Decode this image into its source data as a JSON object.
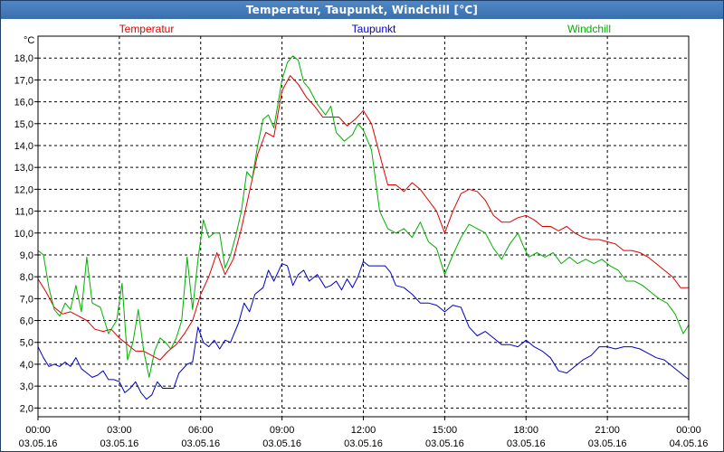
{
  "window": {
    "title": "Temperatur, Taupunkt, Windchill [°C]"
  },
  "chart_data": {
    "type": "line",
    "title": "Temperatur, Taupunkt, Windchill [°C]",
    "ylabel": "°C",
    "ylim": [
      1.6,
      19.0
    ],
    "y_ticks": [
      "2,0",
      "3,0",
      "4,0",
      "5,0",
      "6,0",
      "7,0",
      "8,0",
      "9,0",
      "10,0",
      "11,0",
      "12,0",
      "13,0",
      "14,0",
      "15,0",
      "16,0",
      "17,0",
      "18,0"
    ],
    "x_ticks": [
      {
        "time": "00:00",
        "date": "03.05.16"
      },
      {
        "time": "03:00",
        "date": "03.05.16"
      },
      {
        "time": "06:00",
        "date": "03.05.16"
      },
      {
        "time": "09:00",
        "date": "03.05.16"
      },
      {
        "time": "12:00",
        "date": "03.05.16"
      },
      {
        "time": "15:00",
        "date": "03.05.16"
      },
      {
        "time": "18:00",
        "date": "03.05.16"
      },
      {
        "time": "21:00",
        "date": "03.05.16"
      },
      {
        "time": "00:00",
        "date": "04.05.16"
      }
    ],
    "x_unit": "hours from 03.05.16 00:00",
    "xlim": [
      0,
      24
    ],
    "grid": true,
    "series": [
      {
        "name": "Temperatur",
        "color": "#e00000",
        "points": [
          [
            0,
            7.9
          ],
          [
            0.3,
            7.3
          ],
          [
            0.6,
            6.6
          ],
          [
            0.9,
            6.3
          ],
          [
            1.2,
            6.4
          ],
          [
            1.5,
            6.2
          ],
          [
            1.8,
            6.0
          ],
          [
            2.1,
            5.6
          ],
          [
            2.4,
            5.5
          ],
          [
            2.7,
            5.6
          ],
          [
            3.0,
            5.2
          ],
          [
            3.3,
            4.9
          ],
          [
            3.6,
            4.6
          ],
          [
            3.9,
            4.6
          ],
          [
            4.2,
            4.4
          ],
          [
            4.5,
            4.2
          ],
          [
            4.8,
            4.6
          ],
          [
            5.1,
            4.9
          ],
          [
            5.4,
            5.4
          ],
          [
            5.7,
            6.0
          ],
          [
            6.0,
            7.2
          ],
          [
            6.3,
            8.0
          ],
          [
            6.6,
            9.1
          ],
          [
            6.9,
            8.1
          ],
          [
            7.2,
            8.8
          ],
          [
            7.5,
            10.2
          ],
          [
            7.8,
            11.9
          ],
          [
            8.1,
            13.6
          ],
          [
            8.4,
            14.6
          ],
          [
            8.7,
            14.4
          ],
          [
            9.0,
            16.5
          ],
          [
            9.3,
            17.2
          ],
          [
            9.6,
            16.8
          ],
          [
            9.9,
            16.2
          ],
          [
            10.2,
            15.8
          ],
          [
            10.5,
            15.3
          ],
          [
            10.8,
            15.3
          ],
          [
            11.1,
            15.3
          ],
          [
            11.4,
            14.9
          ],
          [
            11.7,
            15.2
          ],
          [
            12.0,
            15.6
          ],
          [
            12.3,
            15.0
          ],
          [
            12.6,
            13.6
          ],
          [
            12.9,
            12.2
          ],
          [
            13.2,
            12.2
          ],
          [
            13.5,
            11.9
          ],
          [
            13.8,
            12.3
          ],
          [
            14.1,
            12.0
          ],
          [
            14.4,
            11.5
          ],
          [
            14.7,
            11.0
          ],
          [
            15.0,
            10.0
          ],
          [
            15.3,
            11.0
          ],
          [
            15.6,
            11.8
          ],
          [
            15.9,
            12.0
          ],
          [
            16.2,
            11.9
          ],
          [
            16.5,
            11.5
          ],
          [
            16.8,
            10.8
          ],
          [
            17.1,
            10.5
          ],
          [
            17.4,
            10.5
          ],
          [
            17.7,
            10.7
          ],
          [
            18.0,
            10.8
          ],
          [
            18.3,
            10.6
          ],
          [
            18.6,
            10.3
          ],
          [
            18.9,
            10.3
          ],
          [
            19.2,
            10.1
          ],
          [
            19.5,
            10.3
          ],
          [
            19.8,
            10.0
          ],
          [
            20.1,
            9.8
          ],
          [
            20.4,
            9.7
          ],
          [
            20.7,
            9.7
          ],
          [
            21.0,
            9.6
          ],
          [
            21.3,
            9.5
          ],
          [
            21.6,
            9.2
          ],
          [
            21.9,
            9.2
          ],
          [
            22.2,
            9.1
          ],
          [
            22.5,
            8.9
          ],
          [
            22.8,
            8.6
          ],
          [
            23.1,
            8.3
          ],
          [
            23.4,
            8.0
          ],
          [
            23.7,
            7.5
          ],
          [
            24.0,
            7.5
          ]
        ]
      },
      {
        "name": "Taupunkt",
        "color": "#0000c8",
        "points": [
          [
            0,
            4.8
          ],
          [
            0.2,
            4.3
          ],
          [
            0.4,
            3.9
          ],
          [
            0.6,
            4.0
          ],
          [
            0.8,
            3.9
          ],
          [
            1.0,
            4.1
          ],
          [
            1.2,
            3.9
          ],
          [
            1.4,
            4.3
          ],
          [
            1.6,
            3.8
          ],
          [
            1.8,
            3.6
          ],
          [
            2.0,
            3.4
          ],
          [
            2.2,
            3.5
          ],
          [
            2.4,
            3.7
          ],
          [
            2.6,
            3.3
          ],
          [
            2.8,
            3.3
          ],
          [
            3.0,
            3.2
          ],
          [
            3.2,
            2.7
          ],
          [
            3.4,
            2.9
          ],
          [
            3.6,
            3.2
          ],
          [
            3.8,
            2.7
          ],
          [
            4.0,
            2.4
          ],
          [
            4.2,
            2.6
          ],
          [
            4.4,
            3.2
          ],
          [
            4.6,
            2.9
          ],
          [
            4.8,
            2.9
          ],
          [
            5.0,
            2.9
          ],
          [
            5.2,
            3.6
          ],
          [
            5.5,
            4.0
          ],
          [
            5.7,
            4.1
          ],
          [
            5.9,
            5.7
          ],
          [
            6.1,
            5.0
          ],
          [
            6.3,
            4.8
          ],
          [
            6.5,
            5.1
          ],
          [
            6.7,
            4.7
          ],
          [
            6.9,
            5.1
          ],
          [
            7.1,
            5.0
          ],
          [
            7.4,
            5.9
          ],
          [
            7.6,
            6.8
          ],
          [
            7.8,
            6.4
          ],
          [
            8.0,
            7.2
          ],
          [
            8.3,
            7.5
          ],
          [
            8.5,
            8.3
          ],
          [
            8.7,
            7.8
          ],
          [
            9.0,
            8.6
          ],
          [
            9.2,
            8.5
          ],
          [
            9.4,
            7.6
          ],
          [
            9.6,
            8.1
          ],
          [
            9.8,
            8.3
          ],
          [
            10.0,
            7.8
          ],
          [
            10.3,
            8.1
          ],
          [
            10.6,
            7.5
          ],
          [
            10.8,
            7.6
          ],
          [
            11.0,
            7.8
          ],
          [
            11.2,
            7.4
          ],
          [
            11.4,
            7.9
          ],
          [
            11.6,
            7.5
          ],
          [
            11.8,
            8.0
          ],
          [
            12.0,
            8.7
          ],
          [
            12.2,
            8.5
          ],
          [
            12.5,
            8.5
          ],
          [
            12.8,
            8.5
          ],
          [
            13.0,
            8.2
          ],
          [
            13.2,
            7.6
          ],
          [
            13.5,
            7.5
          ],
          [
            13.8,
            7.2
          ],
          [
            14.1,
            6.8
          ],
          [
            14.4,
            6.8
          ],
          [
            14.7,
            6.7
          ],
          [
            15.0,
            6.4
          ],
          [
            15.3,
            6.7
          ],
          [
            15.6,
            6.6
          ],
          [
            15.9,
            5.7
          ],
          [
            16.2,
            5.3
          ],
          [
            16.5,
            5.5
          ],
          [
            16.8,
            5.2
          ],
          [
            17.1,
            4.9
          ],
          [
            17.4,
            4.9
          ],
          [
            17.7,
            4.8
          ],
          [
            18.0,
            5.1
          ],
          [
            18.3,
            4.8
          ],
          [
            18.6,
            4.6
          ],
          [
            18.9,
            4.3
          ],
          [
            19.2,
            3.7
          ],
          [
            19.5,
            3.6
          ],
          [
            19.8,
            3.9
          ],
          [
            20.1,
            4.2
          ],
          [
            20.4,
            4.4
          ],
          [
            20.7,
            4.8
          ],
          [
            21.0,
            4.8
          ],
          [
            21.3,
            4.7
          ],
          [
            21.6,
            4.8
          ],
          [
            21.9,
            4.8
          ],
          [
            22.2,
            4.7
          ],
          [
            22.5,
            4.5
          ],
          [
            22.8,
            4.3
          ],
          [
            23.1,
            4.2
          ],
          [
            23.4,
            3.9
          ],
          [
            23.7,
            3.6
          ],
          [
            24.0,
            3.3
          ]
        ]
      },
      {
        "name": "Windchill",
        "color": "#00b000",
        "points": [
          [
            0,
            9.2
          ],
          [
            0.2,
            9.0
          ],
          [
            0.4,
            7.5
          ],
          [
            0.6,
            6.5
          ],
          [
            0.8,
            6.2
          ],
          [
            1.0,
            6.8
          ],
          [
            1.2,
            6.5
          ],
          [
            1.4,
            7.6
          ],
          [
            1.6,
            6.4
          ],
          [
            1.8,
            8.9
          ],
          [
            2.0,
            6.8
          ],
          [
            2.3,
            6.6
          ],
          [
            2.6,
            5.4
          ],
          [
            2.9,
            6.0
          ],
          [
            3.1,
            7.7
          ],
          [
            3.3,
            4.2
          ],
          [
            3.5,
            5.0
          ],
          [
            3.7,
            6.5
          ],
          [
            3.9,
            4.6
          ],
          [
            4.1,
            3.4
          ],
          [
            4.3,
            4.6
          ],
          [
            4.5,
            5.2
          ],
          [
            4.7,
            5.0
          ],
          [
            4.9,
            4.7
          ],
          [
            5.1,
            5.2
          ],
          [
            5.3,
            6.0
          ],
          [
            5.5,
            8.9
          ],
          [
            5.7,
            6.5
          ],
          [
            5.9,
            8.8
          ],
          [
            6.1,
            10.6
          ],
          [
            6.3,
            9.8
          ],
          [
            6.5,
            10.0
          ],
          [
            6.7,
            10.0
          ],
          [
            6.9,
            8.4
          ],
          [
            7.1,
            9.0
          ],
          [
            7.3,
            9.9
          ],
          [
            7.5,
            11.0
          ],
          [
            7.7,
            12.8
          ],
          [
            7.9,
            12.5
          ],
          [
            8.1,
            14.0
          ],
          [
            8.3,
            15.2
          ],
          [
            8.5,
            15.4
          ],
          [
            8.7,
            14.8
          ],
          [
            9.0,
            17.0
          ],
          [
            9.2,
            17.8
          ],
          [
            9.4,
            18.1
          ],
          [
            9.6,
            17.9
          ],
          [
            9.8,
            16.9
          ],
          [
            10.0,
            16.6
          ],
          [
            10.3,
            15.9
          ],
          [
            10.6,
            15.4
          ],
          [
            10.8,
            15.8
          ],
          [
            11.0,
            14.6
          ],
          [
            11.3,
            14.2
          ],
          [
            11.6,
            14.5
          ],
          [
            11.8,
            15.0
          ],
          [
            12.0,
            14.7
          ],
          [
            12.3,
            13.8
          ],
          [
            12.6,
            11.0
          ],
          [
            12.9,
            10.2
          ],
          [
            13.2,
            10.0
          ],
          [
            13.5,
            10.2
          ],
          [
            13.8,
            9.8
          ],
          [
            14.1,
            10.5
          ],
          [
            14.4,
            9.6
          ],
          [
            14.7,
            9.3
          ],
          [
            15.0,
            8.1
          ],
          [
            15.3,
            9.0
          ],
          [
            15.6,
            9.8
          ],
          [
            15.9,
            10.4
          ],
          [
            16.2,
            10.2
          ],
          [
            16.5,
            10.0
          ],
          [
            16.8,
            9.3
          ],
          [
            17.1,
            8.8
          ],
          [
            17.4,
            9.5
          ],
          [
            17.7,
            10.0
          ],
          [
            17.9,
            9.4
          ],
          [
            18.1,
            8.9
          ],
          [
            18.4,
            9.1
          ],
          [
            18.7,
            8.9
          ],
          [
            19.0,
            9.1
          ],
          [
            19.3,
            8.6
          ],
          [
            19.6,
            8.9
          ],
          [
            19.9,
            8.6
          ],
          [
            20.2,
            8.8
          ],
          [
            20.5,
            8.6
          ],
          [
            20.8,
            8.8
          ],
          [
            21.1,
            8.5
          ],
          [
            21.4,
            8.3
          ],
          [
            21.7,
            7.8
          ],
          [
            22.0,
            7.8
          ],
          [
            22.3,
            7.6
          ],
          [
            22.6,
            7.3
          ],
          [
            22.9,
            7.0
          ],
          [
            23.2,
            6.8
          ],
          [
            23.5,
            6.3
          ],
          [
            23.8,
            5.4
          ],
          [
            24.0,
            5.8
          ]
        ]
      }
    ]
  }
}
